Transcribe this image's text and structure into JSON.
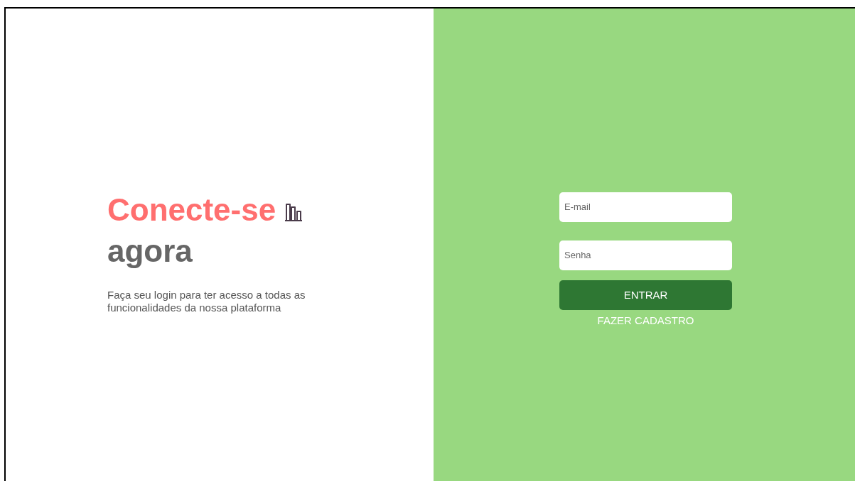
{
  "hero": {
    "title": "Conecte-se",
    "subtitle": "agora",
    "description": "Faça seu login para ter acesso a todas as funcionalidades da nossa plataforma"
  },
  "form": {
    "fields": [
      {
        "placeholder": "E-mail"
      },
      {
        "placeholder": "Senha"
      }
    ],
    "submit": "ENTRAR",
    "link": "FAZER CADASTRO"
  }
}
